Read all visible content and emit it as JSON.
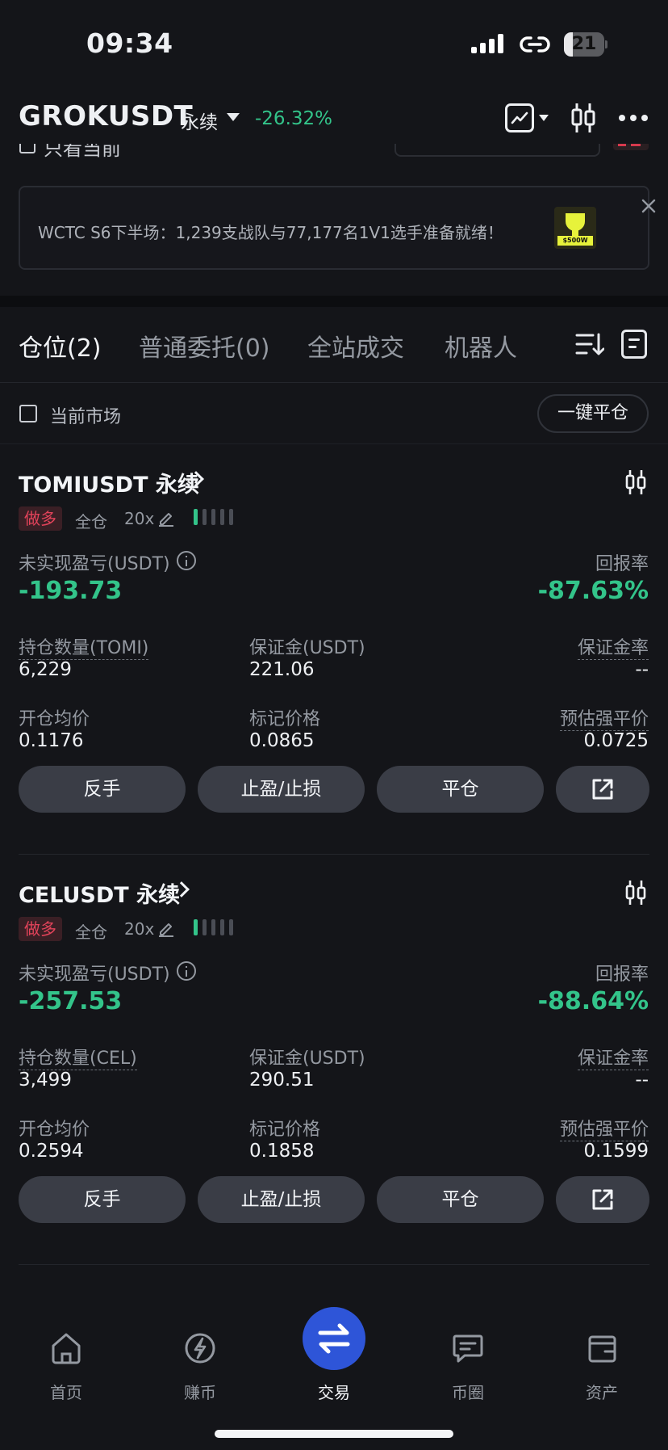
{
  "status_bar": {
    "time": "09:34",
    "battery": "21",
    "battery_level": 0.21
  },
  "header": {
    "pair": "GROKUSDT",
    "contract_type": "永续",
    "change": "-26.32%",
    "icons": [
      "chart-icon",
      "candlestick-icon",
      "more-icon"
    ]
  },
  "clipped_row": {
    "label": "只看当前"
  },
  "banner": {
    "text": "WCTC S6下半场：1,239支战队与77,177名1V1选手准备就绪！",
    "image_label": "$500W"
  },
  "tabs": [
    {
      "label": "仓位(2)",
      "active": true
    },
    {
      "label": "普通委托(0)",
      "active": false
    },
    {
      "label": "全站成交",
      "active": false
    },
    {
      "label": "机器人",
      "active": false
    }
  ],
  "filter": {
    "current_market_label": "当前市场",
    "close_all_label": "一键平仓"
  },
  "positions": [
    {
      "symbol": "TOMIUSDT 永续",
      "side": "做多",
      "margin_mode": "全仓",
      "leverage": "20x",
      "risk_level": 1,
      "pnl_label": "未实现盈亏(USDT)",
      "pnl": "-193.73",
      "roe_label": "回报率",
      "roe": "-87.63%",
      "qty_label": "持仓数量(TOMI)",
      "qty": "6,229",
      "margin_label": "保证金(USDT)",
      "margin": "221.06",
      "margin_ratio_label": "保证金率",
      "margin_ratio": "--",
      "entry_label": "开仓均价",
      "entry": "0.1176",
      "mark_label": "标记价格",
      "mark": "0.0865",
      "liq_label": "预估强平价",
      "liq": "0.0725",
      "actions": [
        "反手",
        "止盈/止损",
        "平仓"
      ]
    },
    {
      "symbol": "CELUSDT 永续",
      "side": "做多",
      "margin_mode": "全仓",
      "leverage": "20x",
      "risk_level": 1,
      "pnl_label": "未实现盈亏(USDT)",
      "pnl": "-257.53",
      "roe_label": "回报率",
      "roe": "-88.64%",
      "qty_label": "持仓数量(CEL)",
      "qty": "3,499",
      "margin_label": "保证金(USDT)",
      "margin": "290.51",
      "margin_ratio_label": "保证金率",
      "margin_ratio": "--",
      "entry_label": "开仓均价",
      "entry": "0.2594",
      "mark_label": "标记价格",
      "mark": "0.1858",
      "liq_label": "预估强平价",
      "liq": "0.1599",
      "actions": [
        "反手",
        "止盈/止损",
        "平仓"
      ]
    }
  ],
  "bottom_nav": [
    {
      "label": "首页",
      "icon": "home-icon",
      "active": false
    },
    {
      "label": "赚币",
      "icon": "earn-icon",
      "active": false
    },
    {
      "label": "交易",
      "icon": "trade-icon",
      "active": true
    },
    {
      "label": "币圈",
      "icon": "community-icon",
      "active": false
    },
    {
      "label": "资产",
      "icon": "wallet-icon",
      "active": false
    }
  ],
  "colors": {
    "up": "#33c48a",
    "down_badge": "#e2435a",
    "accent": "#2e55d8",
    "background": "#141519"
  }
}
